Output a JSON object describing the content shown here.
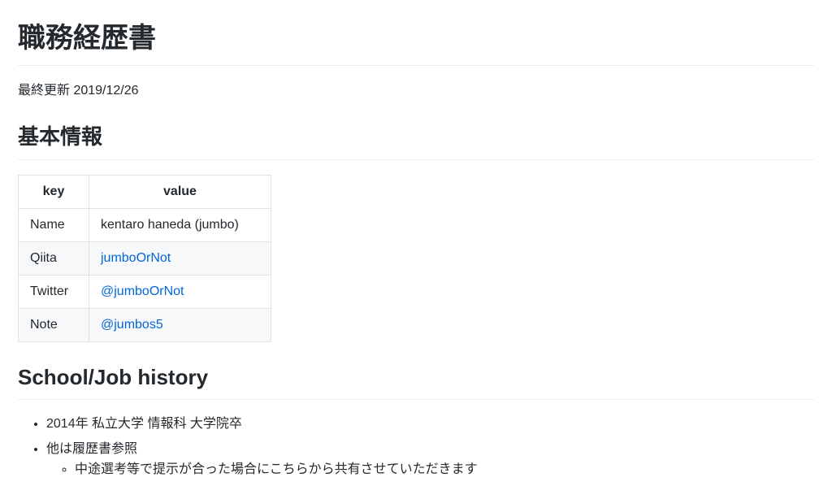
{
  "title": "職務経歴書",
  "updated": "最終更新 2019/12/26",
  "basic_info": {
    "heading": "基本情報",
    "headers": [
      "key",
      "value"
    ],
    "rows": [
      {
        "key": "Name",
        "value": "kentaro haneda (jumbo)",
        "is_link": false
      },
      {
        "key": "Qiita",
        "value": "jumboOrNot",
        "is_link": true
      },
      {
        "key": "Twitter",
        "value": "@jumboOrNot",
        "is_link": true
      },
      {
        "key": "Note",
        "value": "@jumbos5",
        "is_link": true
      }
    ]
  },
  "history": {
    "heading": "School/Job history",
    "items": [
      {
        "text": "2014年 私立大学 情報科 大学院卒"
      },
      {
        "text": "他は履歴書参照",
        "children": [
          "中途選考等で提示が合った場合にこちらから共有させていただきます"
        ]
      }
    ]
  },
  "colors": {
    "text": "#24292e",
    "link": "#0366d6",
    "border": "#dfe2e5",
    "row_alt": "#f6f8fa",
    "divider": "#eaecef"
  }
}
